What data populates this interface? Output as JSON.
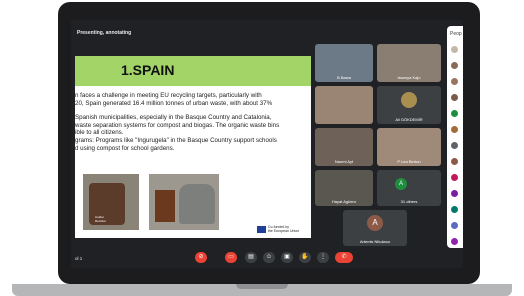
{
  "meeting": {
    "status": "Presenting, annotating",
    "name_fragment": "ol 1"
  },
  "slide": {
    "title": "1.SPAIN",
    "lines": [
      "n faces a challenge in meeting EU recycling targets, particularly with",
      "20, Spain generated 16.4 million tonnes of urban waste, with about 37%",
      "Spanish municipalities, especially in the Basque Country and Catalonia,",
      "waste separation systems for compost and biogas. The organic waste bins",
      "ible to all citizens.",
      "grams: Programs like \"Ingurugela\" in the Basque Country support schools",
      "d using compost for school gardens."
    ],
    "bin_label": "Cuidar Reciclar",
    "eu_text_1": "Co-funded by",
    "eu_text_2": "the European Union"
  },
  "participants": {
    "tiles": [
      {
        "name": "B Bawa"
      },
      {
        "name": "Iswarya Kaju"
      },
      {
        "name": ""
      },
      {
        "name": "Ali GÖKDEMİR"
      },
      {
        "name": "Naomi Ayt"
      },
      {
        "name": "P Lea Berton"
      },
      {
        "name": "Hayat Agüero"
      },
      {
        "name": "31 others"
      }
    ],
    "presenter": {
      "initial": "A",
      "name": "Artemis Nikolaou"
    },
    "others_initial": "A"
  },
  "people_panel": {
    "label": "Peop"
  },
  "controls": [
    "mic-off",
    "camera-off",
    "captions",
    "emoji",
    "present",
    "raise-hand",
    "more",
    "leave"
  ],
  "colors": {
    "accent_red": "#ea4335",
    "slide_banner": "#a2d468",
    "tile_bg": "#3c4043"
  }
}
